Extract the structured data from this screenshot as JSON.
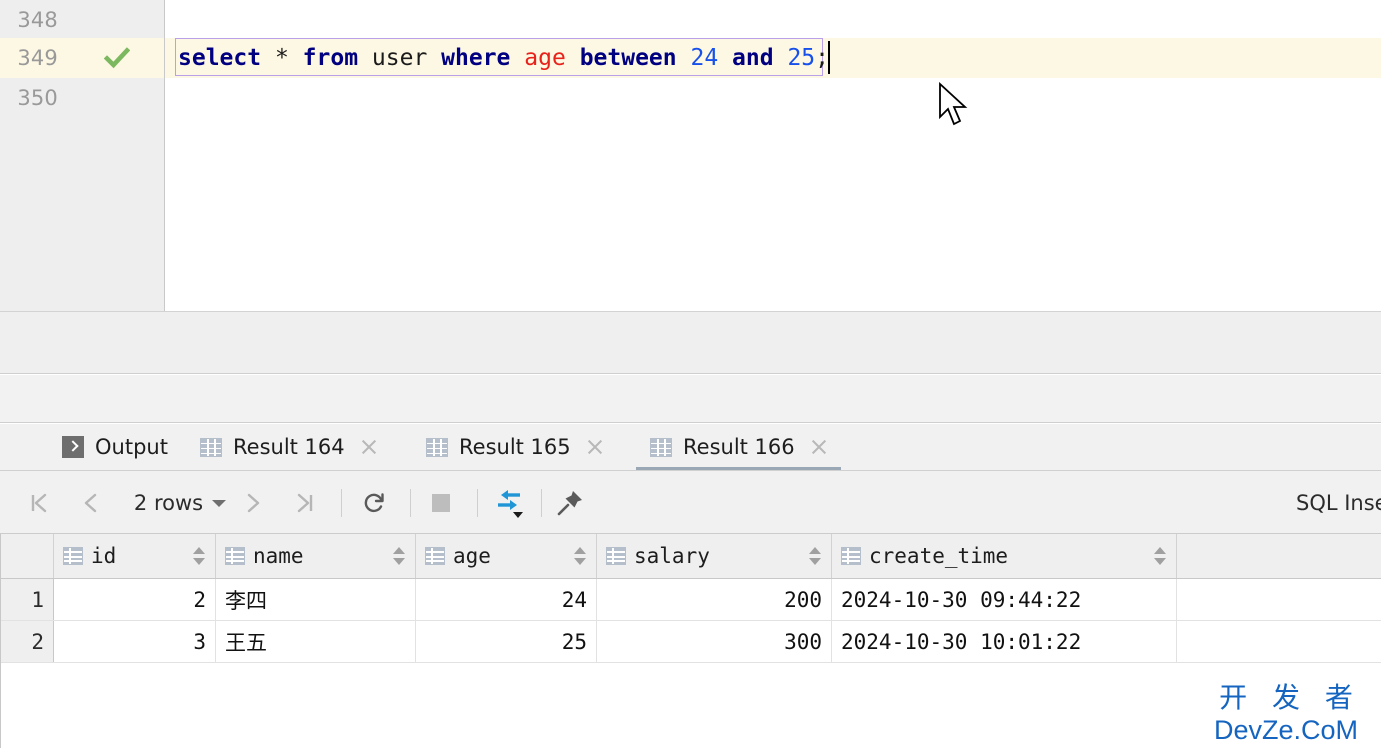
{
  "editor": {
    "lines": [
      {
        "number": "348",
        "status": "",
        "code": ""
      },
      {
        "number": "349",
        "status": "check-mark",
        "code": "select * from user where age between 24 and 25;"
      },
      {
        "number": "350",
        "status": "",
        "code": ""
      }
    ],
    "sql_tokens": [
      {
        "text": "select",
        "type": "keyword"
      },
      {
        "text": " ",
        "type": "plain"
      },
      {
        "text": "*",
        "type": "operator"
      },
      {
        "text": " ",
        "type": "plain"
      },
      {
        "text": "from",
        "type": "keyword"
      },
      {
        "text": " ",
        "type": "plain"
      },
      {
        "text": "user",
        "type": "identifier"
      },
      {
        "text": " ",
        "type": "plain"
      },
      {
        "text": "where",
        "type": "keyword"
      },
      {
        "text": " ",
        "type": "plain"
      },
      {
        "text": "age",
        "type": "column"
      },
      {
        "text": " ",
        "type": "plain"
      },
      {
        "text": "between",
        "type": "keyword"
      },
      {
        "text": " ",
        "type": "plain"
      },
      {
        "text": "24",
        "type": "number"
      },
      {
        "text": " ",
        "type": "plain"
      },
      {
        "text": "and",
        "type": "keyword"
      },
      {
        "text": " ",
        "type": "plain"
      },
      {
        "text": "25",
        "type": "number"
      },
      {
        "text": ";",
        "type": "semicolon"
      }
    ],
    "colors": {
      "keyword": "#000080",
      "column": "#e8231c",
      "number": "#1750eb",
      "identifier": "#1b1b1b",
      "current_line_bg": "#fdf8e3",
      "caret_box_border": "#b9a0e8",
      "gutter_bg": "#eeeeee",
      "check_mark": "#7cb860"
    }
  },
  "tabs": [
    {
      "label": "Output",
      "icon": "output-console-icon",
      "closable": false,
      "active": false
    },
    {
      "label": "Result 164",
      "icon": "result-grid-icon",
      "closable": true,
      "active": false
    },
    {
      "label": "Result 165",
      "icon": "result-grid-icon",
      "closable": true,
      "active": false
    },
    {
      "label": "Result 166",
      "icon": "result-grid-icon",
      "closable": true,
      "active": true
    }
  ],
  "toolbar": {
    "first_page": "first-page-icon",
    "prev_page": "previous-page-icon",
    "rows_label": "2 rows",
    "rows_dropdown": "chevron-down-icon",
    "next_page": "next-page-icon",
    "last_page": "last-page-icon",
    "reload": "refresh-icon",
    "stop": "stop-icon",
    "transpose": "transpose-icon",
    "pin": "pin-tab-icon",
    "right_label": "SQL Inse"
  },
  "grid": {
    "columns": [
      {
        "label": "id",
        "align": "right"
      },
      {
        "label": "name",
        "align": "left"
      },
      {
        "label": "age",
        "align": "right"
      },
      {
        "label": "salary",
        "align": "right"
      },
      {
        "label": "create_time",
        "align": "left"
      }
    ],
    "rows": [
      {
        "num": "1",
        "id": "2",
        "name": "李四",
        "age": "24",
        "salary": "200",
        "create_time": "2024-10-30 09:44:22"
      },
      {
        "num": "2",
        "id": "3",
        "name": "王五",
        "age": "25",
        "salary": "300",
        "create_time": "2024-10-30 10:01:22"
      }
    ]
  },
  "watermark": {
    "line1": "开 发 者",
    "line2": "DevZe.CoM",
    "color": "#1565c0"
  }
}
